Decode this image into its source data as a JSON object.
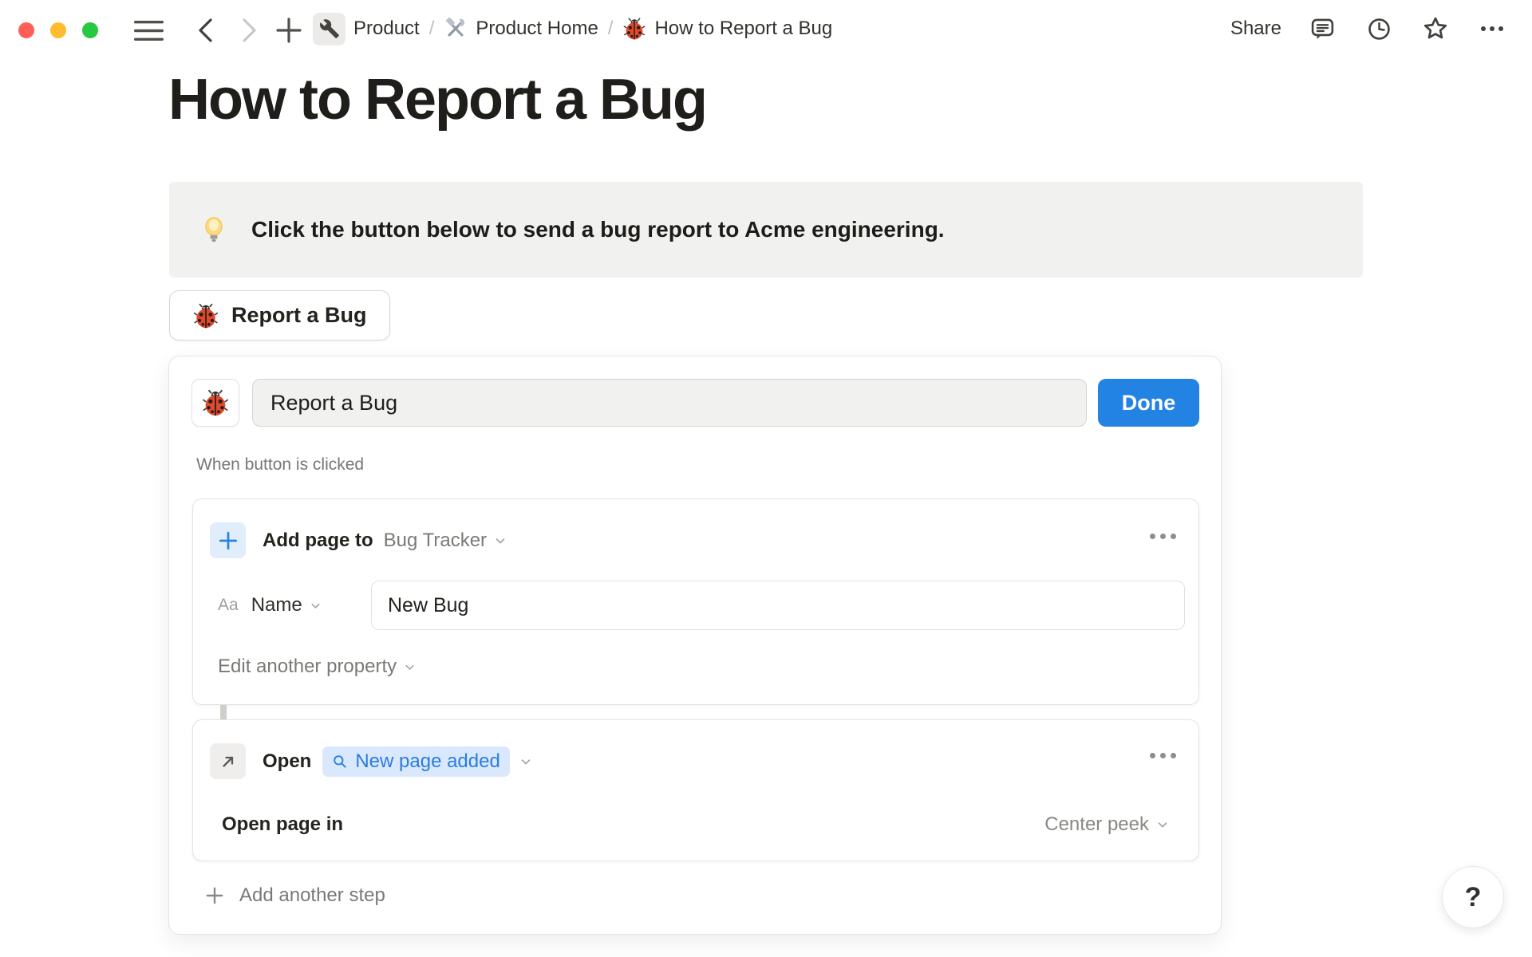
{
  "topbar": {
    "separator": "/",
    "breadcrumbs": [
      {
        "icon": "wrench-icon",
        "label": "Product"
      },
      {
        "icon": "hammer-wrench-icon",
        "label": "Product Home"
      },
      {
        "icon": "ladybug-icon",
        "label": "How to Report a Bug"
      }
    ],
    "share_label": "Share"
  },
  "page": {
    "title": "How to Report a Bug",
    "callout": {
      "icon": "light-bulb-icon",
      "text": "Click the button below to send a bug report to Acme engineering."
    },
    "bug_button_label": "Report a Bug"
  },
  "editor": {
    "name_value": "Report a Bug",
    "done_label": "Done",
    "trigger_label": "When button is clicked",
    "step1": {
      "action_label": "Add page to",
      "target": "Bug Tracker",
      "property_type_label": "Aa",
      "property_name": "Name",
      "property_value": "New Bug",
      "edit_another_label": "Edit another property"
    },
    "step2": {
      "action_label": "Open",
      "target": "New page added",
      "detail_label": "Open page in",
      "detail_value": "Center peek"
    },
    "add_step_label": "Add another step"
  },
  "help_label": "?",
  "colors": {
    "accent_blue": "#2383e2",
    "chip_background": "#d9e8fc",
    "callout_background": "#f1f1ef",
    "traffic_red": "#ff5f57",
    "traffic_yellow": "#febc2e",
    "traffic_green": "#28c840"
  }
}
